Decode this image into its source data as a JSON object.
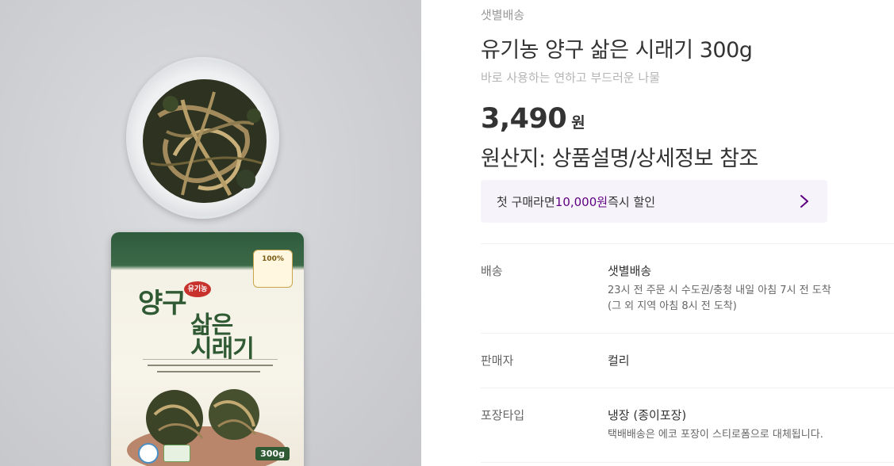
{
  "product": {
    "brand": "샛별배송",
    "title": "유기농 양구 삶은 시래기 300g",
    "subtitle": "바로 사용하는 연하고 부드러운 나물",
    "price": "3,490",
    "currency": "원",
    "origin": "원산지: 상품설명/상세정보 참조"
  },
  "coupon": {
    "prefix": "첫 구매라면 ",
    "amount": "10,000원",
    "suffix": " 즉시 할인",
    "arrow_icon": "chevron-right-icon",
    "accent_color": "#5f0080"
  },
  "package": {
    "title_line1": "양구",
    "title_organic": "유기농",
    "title_line2_a": "삶은",
    "title_line2_b": "시래기",
    "badge": "100%",
    "weight": "300g"
  },
  "details": [
    {
      "label": "배송",
      "value": "샛별배송",
      "notes": [
        "23시 전 주문 시 수도권/충청 내일 아침 7시 전 도착",
        "(그 외 지역 아침 8시 전 도착)"
      ]
    },
    {
      "label": "판매자",
      "value": "컬리",
      "notes": []
    },
    {
      "label": "포장타입",
      "value": "냉장 (종이포장)",
      "notes": [
        "택배배송은 에코 포장이 스티로폼으로 대체됩니다."
      ]
    }
  ]
}
